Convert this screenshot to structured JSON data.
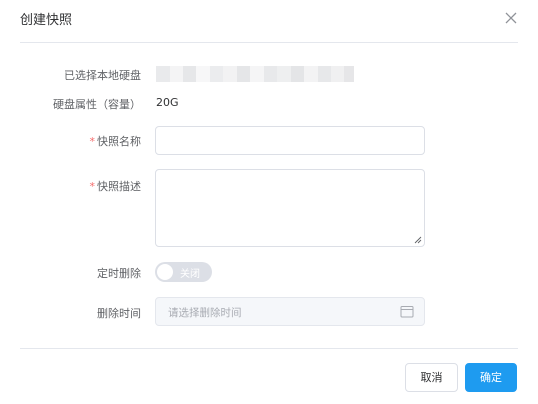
{
  "dialog": {
    "title": "创建快照",
    "close_icon": "close-icon"
  },
  "form": {
    "selected_disk": {
      "label": "已选择本地硬盘",
      "value_redacted": true
    },
    "disk_capacity": {
      "label": "硬盘属性（容量）",
      "value": "20G"
    },
    "snapshot_name": {
      "required_mark": "*",
      "label": "快照名称",
      "value": ""
    },
    "snapshot_description": {
      "required_mark": "*",
      "label": "快照描述",
      "value": ""
    },
    "scheduled_delete": {
      "label": "定时删除",
      "toggle_text": "关闭",
      "enabled": false
    },
    "delete_time": {
      "label": "删除时间",
      "placeholder": "请选择删除时间",
      "disabled": true,
      "icon": "calendar-icon"
    }
  },
  "footer": {
    "cancel_label": "取消",
    "confirm_label": "确定"
  },
  "colors": {
    "accent": "#1e9bf0",
    "required": "#f56c6c",
    "border": "#dcdfe6",
    "switch_off": "#dcdfe6",
    "disabled_bg": "#f5f7fa"
  }
}
